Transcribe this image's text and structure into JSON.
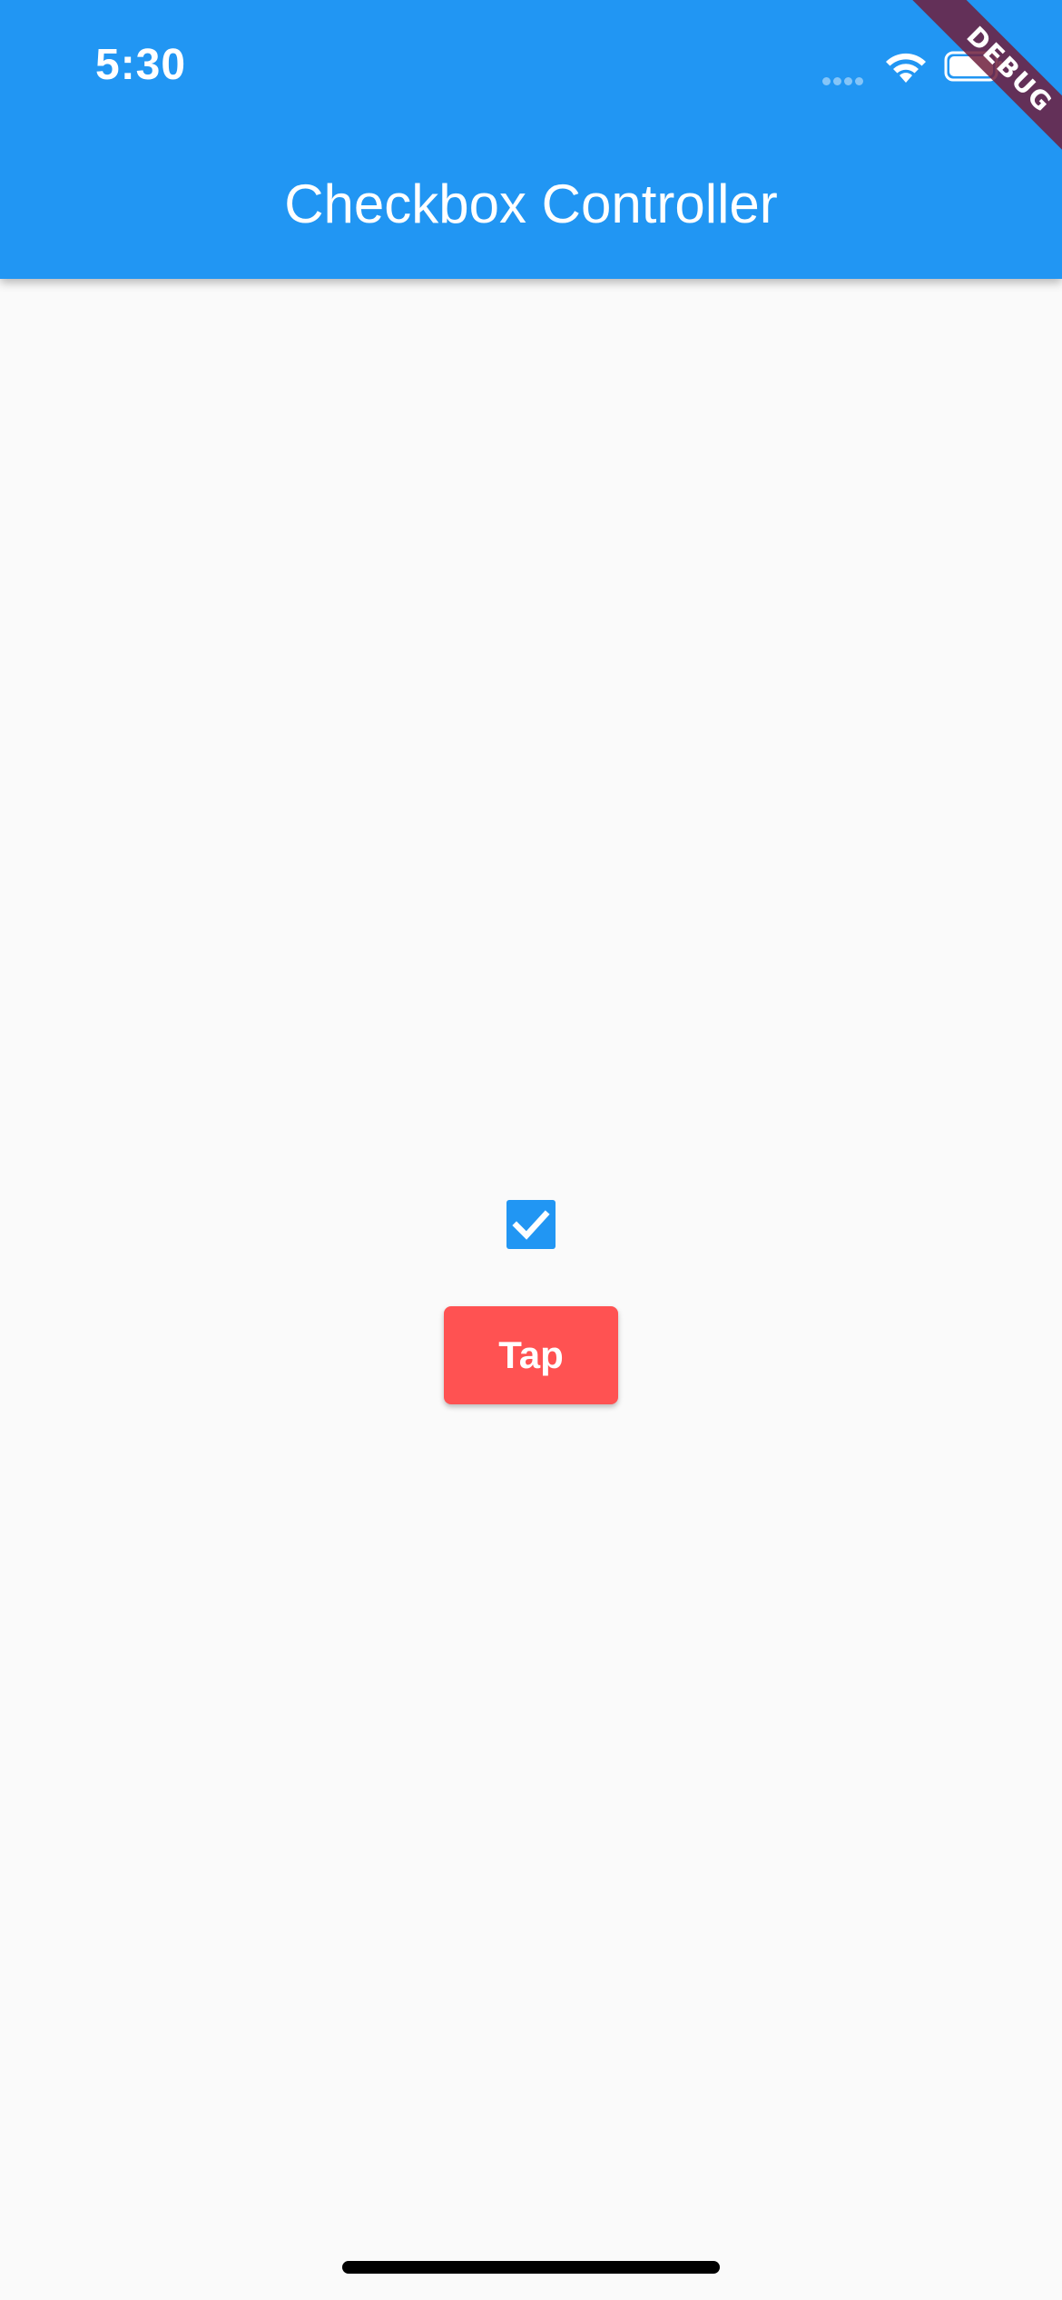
{
  "status_bar": {
    "time": "5:30",
    "icons": [
      "signal-dots-icon",
      "wifi-icon",
      "battery-icon"
    ]
  },
  "app_bar": {
    "title": "Checkbox Controller",
    "color": "#2196f3"
  },
  "debug_banner": {
    "label": "DEBUG"
  },
  "checkbox": {
    "checked": true,
    "color": "#2196f3"
  },
  "tap_button": {
    "label": "Tap",
    "color": "#ff5252"
  }
}
